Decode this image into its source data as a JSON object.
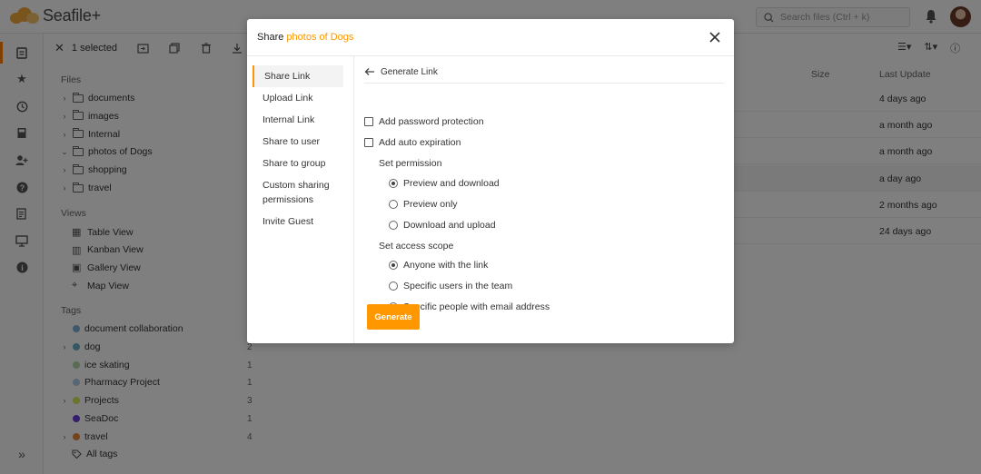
{
  "app": {
    "name": "Seafile+"
  },
  "header": {
    "search_placeholder": "Search files (Ctrl + k)"
  },
  "toolbar": {
    "selected_label": "1 selected"
  },
  "tree": {
    "files_heading": "Files",
    "folders": [
      {
        "name": "documents",
        "expanded": false
      },
      {
        "name": "images",
        "expanded": false
      },
      {
        "name": "Internal",
        "expanded": false
      },
      {
        "name": "photos of Dogs",
        "expanded": true
      },
      {
        "name": "shopping",
        "expanded": false
      },
      {
        "name": "travel",
        "expanded": false
      }
    ],
    "views_heading": "Views",
    "views": [
      {
        "name": "Table View",
        "icon": "table-icon"
      },
      {
        "name": "Kanban View",
        "icon": "kanban-icon"
      },
      {
        "name": "Gallery View",
        "icon": "gallery-icon"
      },
      {
        "name": "Map View",
        "icon": "map-icon"
      }
    ],
    "tags_heading": "Tags",
    "tags": [
      {
        "name": "document collaboration",
        "count": "",
        "color": "#7fb0d8",
        "expandable": false
      },
      {
        "name": "dog",
        "count": "2",
        "color": "#6ab0c8",
        "expandable": true
      },
      {
        "name": "ice skating",
        "count": "1",
        "color": "#b0d8a8",
        "expandable": false
      },
      {
        "name": "Pharmacy Project",
        "count": "1",
        "color": "#b0cce6",
        "expandable": false
      },
      {
        "name": "Projects",
        "count": "3",
        "color": "#d8e85a",
        "expandable": true
      },
      {
        "name": "SeaDoc",
        "count": "1",
        "color": "#6a3de0",
        "expandable": false
      },
      {
        "name": "travel",
        "count": "4",
        "color": "#e8883a",
        "expandable": true
      }
    ],
    "all_tags_label": "All tags"
  },
  "main": {
    "columns": {
      "size": "Size",
      "last_update": "Last Update"
    },
    "rows": [
      "4 days ago",
      "a month ago",
      "a month ago",
      "a day ago",
      "2 months ago",
      "24 days ago"
    ]
  },
  "dialog": {
    "title_prefix": "Share",
    "title_item": "photos of Dogs",
    "nav": [
      "Share Link",
      "Upload Link",
      "Internal Link",
      "Share to user",
      "Share to group",
      "Custom sharing permissions",
      "Invite Guest"
    ],
    "back_label": "Generate Link",
    "password_label": "Add password protection",
    "expiration_label": "Add auto expiration",
    "permission_heading": "Set permission",
    "permissions": [
      {
        "label": "Preview and download",
        "selected": true
      },
      {
        "label": "Preview only",
        "selected": false
      },
      {
        "label": "Download and upload",
        "selected": false
      }
    ],
    "scope_heading": "Set access scope",
    "scopes": [
      {
        "label": "Anyone with the link",
        "selected": true
      },
      {
        "label": "Specific users in the team",
        "selected": false
      },
      {
        "label": "Specific people with email address",
        "selected": false
      }
    ],
    "generate_label": "Generate"
  },
  "colors": {
    "accent": "#ff9800",
    "overlay": "rgba(0,0,0,0.5)"
  }
}
